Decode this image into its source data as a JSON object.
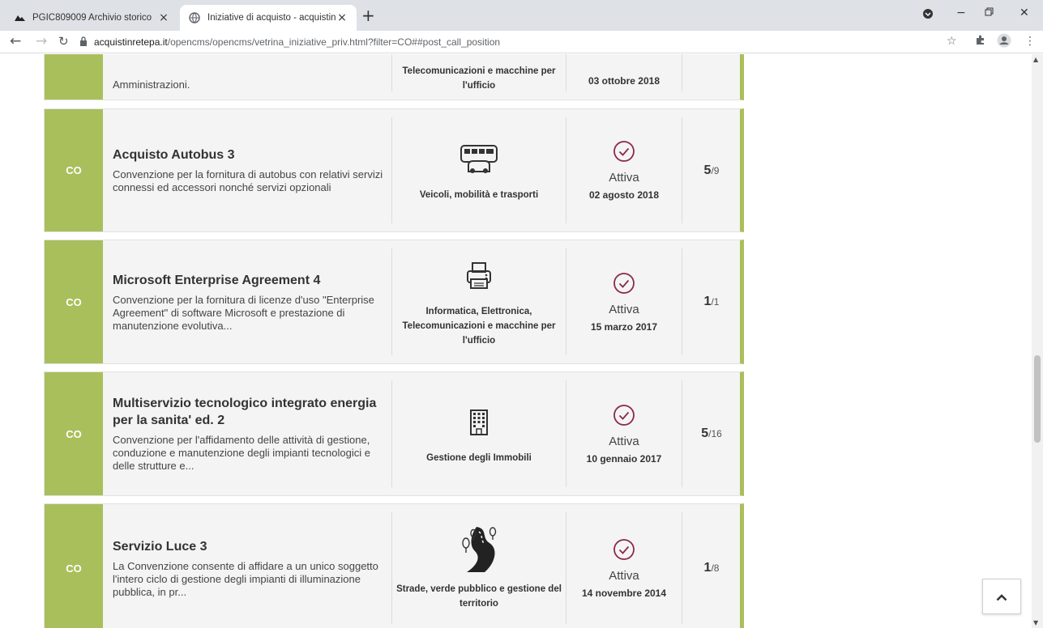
{
  "browser": {
    "tabs": [
      {
        "title": "PGIC809009 Archivio storico",
        "close": "×"
      },
      {
        "title": "Iniziative di acquisto - acquistinre",
        "close": "×"
      }
    ],
    "new_tab": "+",
    "address": {
      "domain": "acquistinretepa.it",
      "path": "/opencms/opencms/vetrina_iniziative_priv.html?filter=CO##post_call_position"
    }
  },
  "top_card": {
    "description": "Amministrazioni.",
    "category": "Telecomunicazioni e macchine per l'ufficio",
    "date": "03 ottobre 2018"
  },
  "cards": [
    {
      "code": "CO",
      "title": "Acquisto Autobus 3",
      "description": "Convenzione per la fornitura di autobus con relativi servizi connessi ed accessori nonché servizi opzionali",
      "category_icon": "bus-icon",
      "category": "Veicoli, mobilità e trasporti",
      "status": "Attiva",
      "date": "02 agosto 2018",
      "lots_active": "5",
      "lots_total": "/9"
    },
    {
      "code": "CO",
      "title": "Microsoft Enterprise Agreement 4",
      "description": "Convenzione per la fornitura di licenze d'uso \"Enterprise Agreement\" di software Microsoft e prestazione di manutenzione evolutiva...",
      "category_icon": "printer-icon",
      "category": "Informatica, Elettronica, Telecomunicazioni e macchine per l'ufficio",
      "status": "Attiva",
      "date": "15 marzo 2017",
      "lots_active": "1",
      "lots_total": "/1"
    },
    {
      "code": "CO",
      "title": "Multiservizio tecnologico integrato energia per la sanita' ed. 2",
      "description": "Convenzione per l'affidamento delle attività di gestione, conduzione e manutenzione degli impianti tecnologici e delle strutture e...",
      "category_icon": "building-icon",
      "category": "Gestione degli Immobili",
      "status": "Attiva",
      "date": "10 gennaio 2017",
      "lots_active": "5",
      "lots_total": "/16"
    },
    {
      "code": "CO",
      "title": "Servizio Luce 3",
      "description": "La Convenzione consente di affidare a un unico soggetto l'intero ciclo di gestione degli impianti di illuminazione pubblica, in pr...",
      "category_icon": "road-trees-icon",
      "category": "Strade, verde pubblico e gestione del territorio",
      "status": "Attiva",
      "date": "14 novembre 2014",
      "lots_active": "1",
      "lots_total": "/8"
    }
  ],
  "colors": {
    "accent_green": "#a9bf5b",
    "status_maroon": "#8b2a4a",
    "card_bg": "#f4f4f4"
  }
}
